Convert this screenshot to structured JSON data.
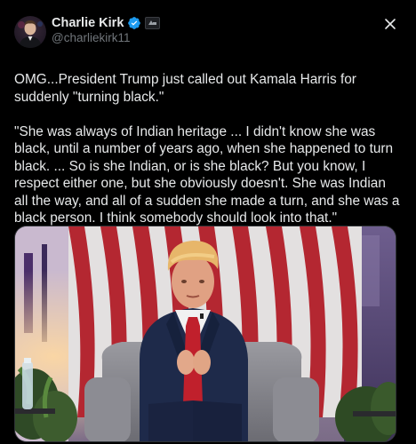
{
  "author": {
    "display_name": "Charlie Kirk",
    "handle": "@charliekirk11",
    "verified": true,
    "verified_color": "#1d9bf0",
    "avatar_icon": "avatar-photo",
    "affiliate_icon": "affiliate-badge-icon"
  },
  "header_actions": {
    "close_icon": "close-icon"
  },
  "tweet": {
    "paragraphs": [
      "OMG...President Trump just called out Kamala Harris for suddenly \"turning black.\"",
      "\"She was always of Indian heritage ... I didn't know she was black, until a number of years ago, when she happened to turn black. ... So is she Indian, or is she black? But you know, I respect either one, but she obviously doesn't. She was Indian all the way, and all of a sudden she made a turn, and she was a black person. I think somebody should look into that.\""
    ]
  },
  "media": {
    "type": "photo",
    "description_icon": "speaker-on-stage-photo"
  },
  "colors": {
    "background": "#000000",
    "text": "#e7e9ea",
    "secondary": "#71767b",
    "accent": "#1d9bf0"
  }
}
